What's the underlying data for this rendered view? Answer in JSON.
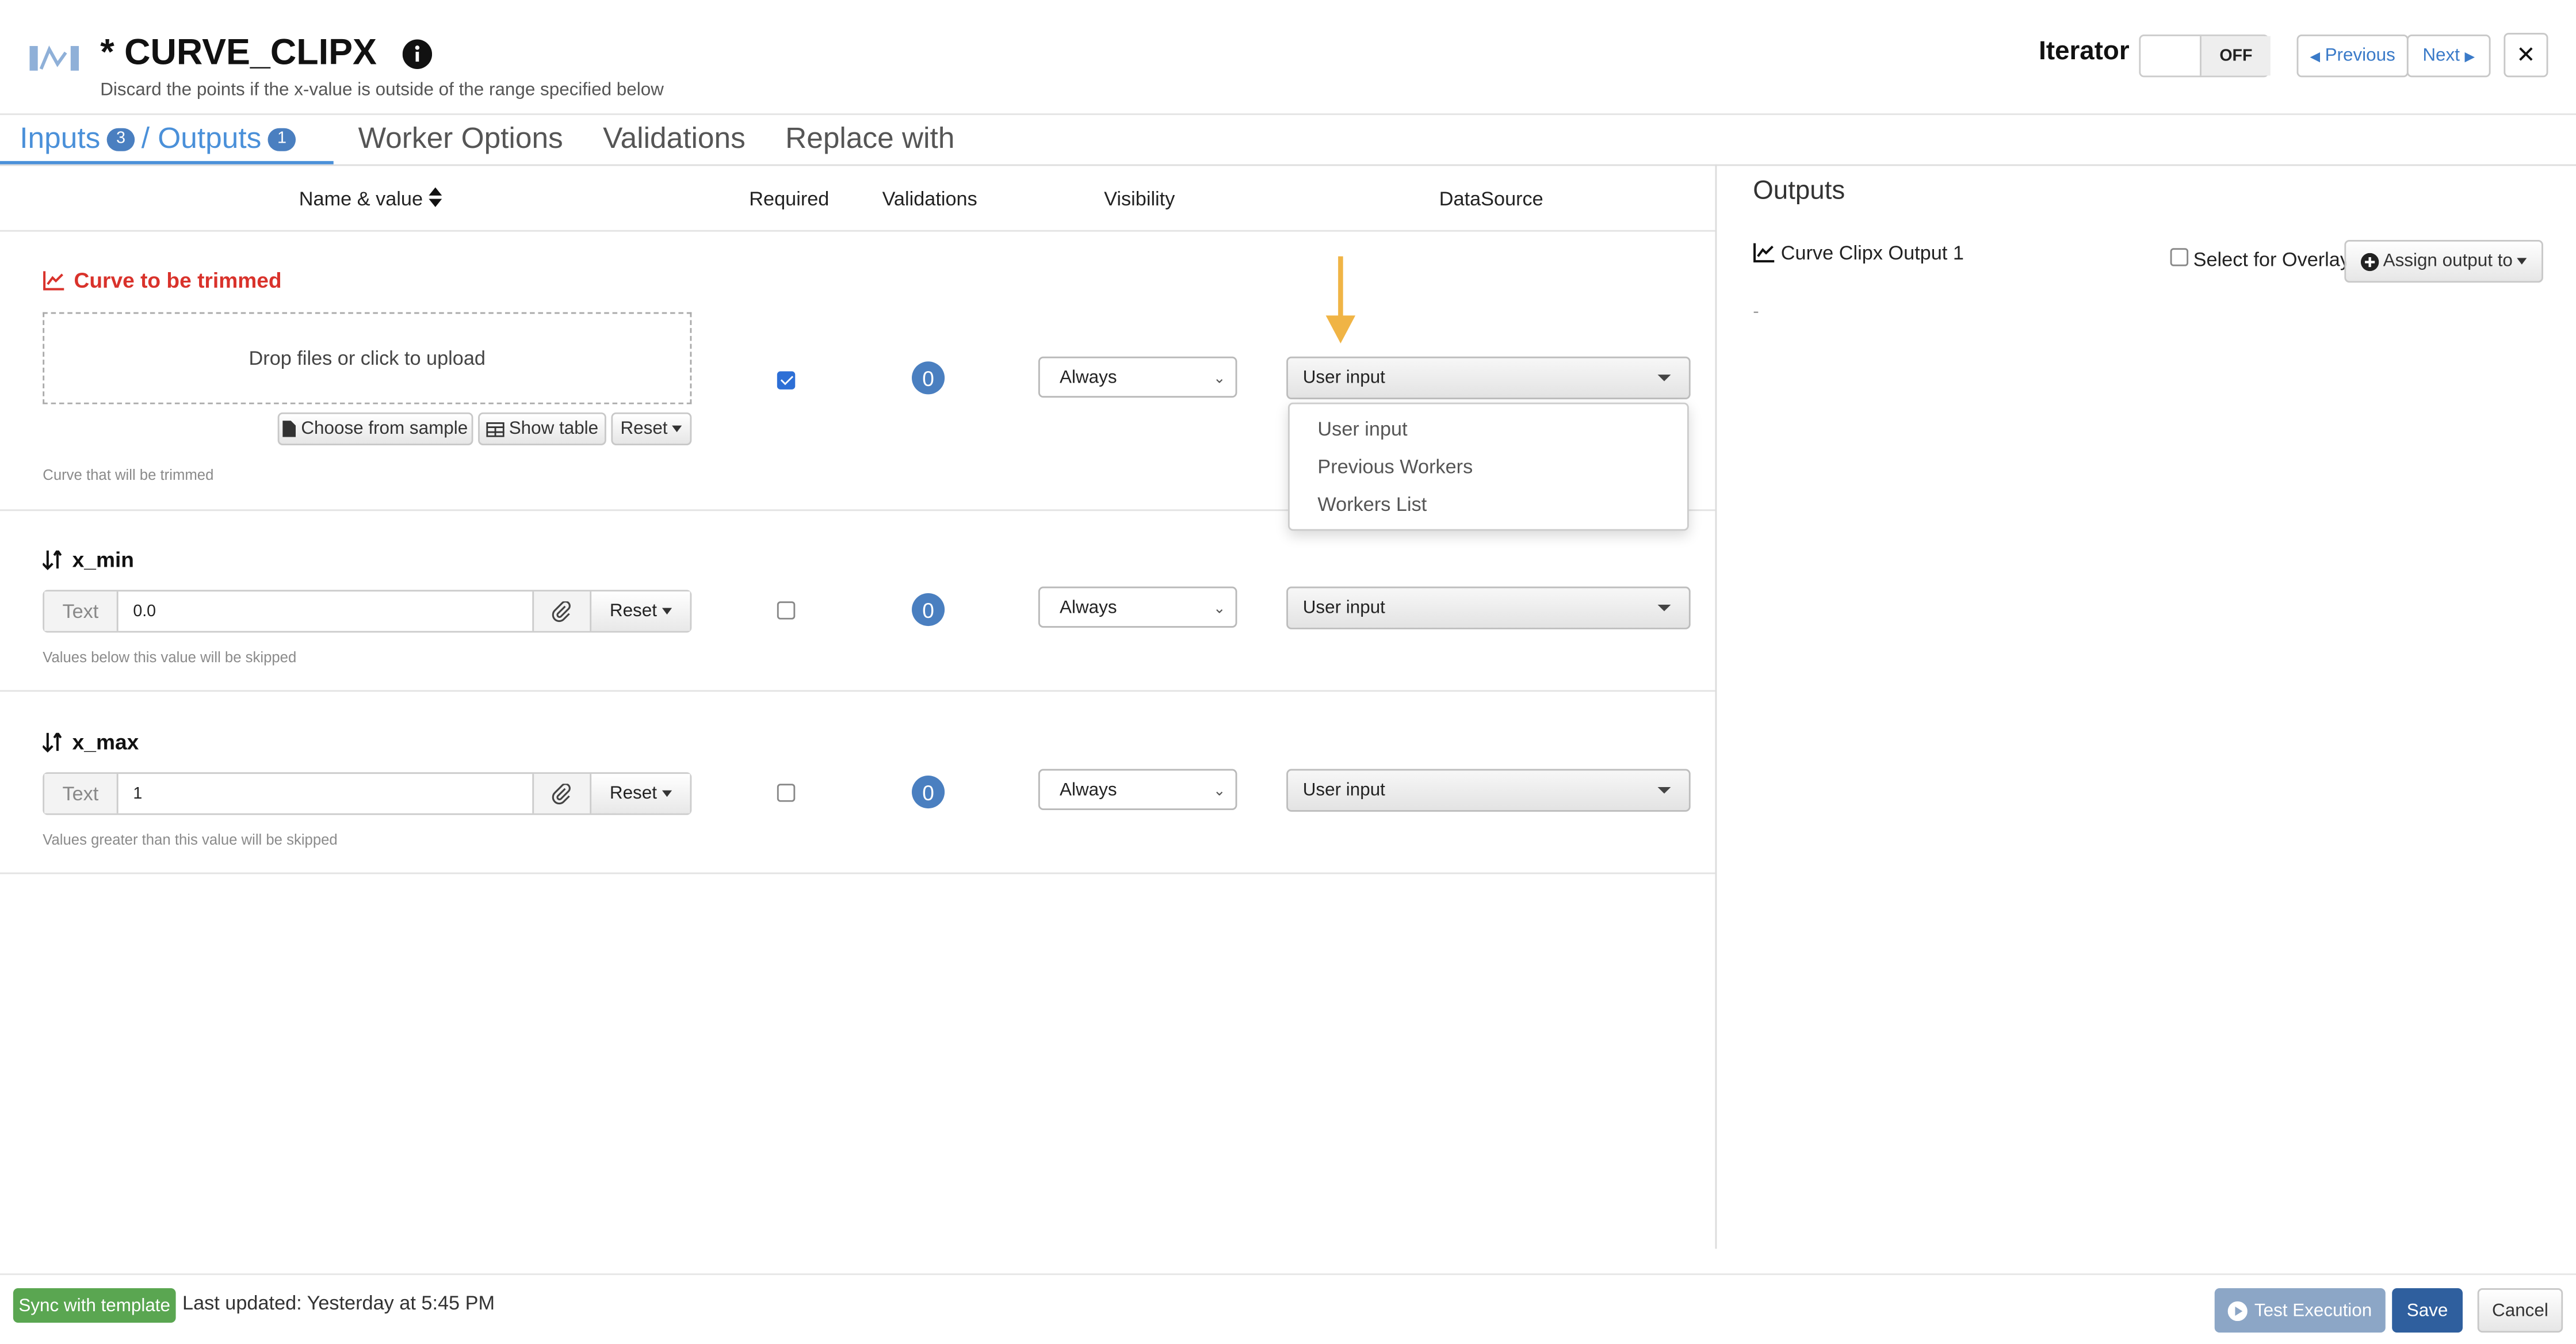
{
  "header": {
    "title": "* CURVE_CLIPX",
    "subtitle": "Discard the points if the x-value is outside of the range specified below",
    "iterator_label": "Iterator",
    "iterator_state": "OFF",
    "previous_label": "Previous",
    "next_label": "Next",
    "close_symbol": "✕"
  },
  "tabs": {
    "inputs_label": "Inputs",
    "inputs_count": "3",
    "outputs_label": "/ Outputs",
    "outputs_count": "1",
    "worker_options": "Worker Options",
    "validations": "Validations",
    "replace_with": "Replace with"
  },
  "columns": {
    "name_value": "Name & value",
    "required": "Required",
    "validations": "Validations",
    "visibility": "Visibility",
    "datasource": "DataSource"
  },
  "params": [
    {
      "title": "Curve to be trimmed",
      "drop_text": "Drop files or click to upload",
      "choose_sample": "Choose from sample",
      "show_table": "Show table",
      "reset": "Reset",
      "hint": "Curve that will be trimmed",
      "required": true,
      "validations": "0",
      "visibility": "Always",
      "datasource": "User input"
    },
    {
      "title": "x_min",
      "addon": "Text",
      "value": "0.0",
      "reset": "Reset",
      "hint": "Values below this value will be skipped",
      "required": false,
      "validations": "0",
      "visibility": "Always",
      "datasource": "User input"
    },
    {
      "title": "x_max",
      "addon": "Text",
      "value": "1",
      "reset": "Reset",
      "hint": "Values greater than this value will be skipped",
      "required": false,
      "validations": "0",
      "visibility": "Always",
      "datasource": "User input"
    }
  ],
  "datasource_menu": [
    "User input",
    "Previous Workers",
    "Workers List"
  ],
  "outputs_panel": {
    "heading": "Outputs",
    "output_name": "Curve Clipx Output 1",
    "select_overlay": "Select for Overlay",
    "assign_output": "Assign output to",
    "placeholder": "-"
  },
  "footer": {
    "sync": "Sync with template",
    "last_updated": "Last updated: Yesterday at 5:45 PM",
    "test_execution": "Test Execution",
    "save": "Save",
    "cancel": "Cancel"
  },
  "colors": {
    "accent": "#4a90d9",
    "badge": "#4a7fc0",
    "error_title": "#d9322b",
    "annotation_arrow": "#f0b445",
    "sync_green": "#5aa651",
    "save_blue": "#2f5f9e"
  }
}
